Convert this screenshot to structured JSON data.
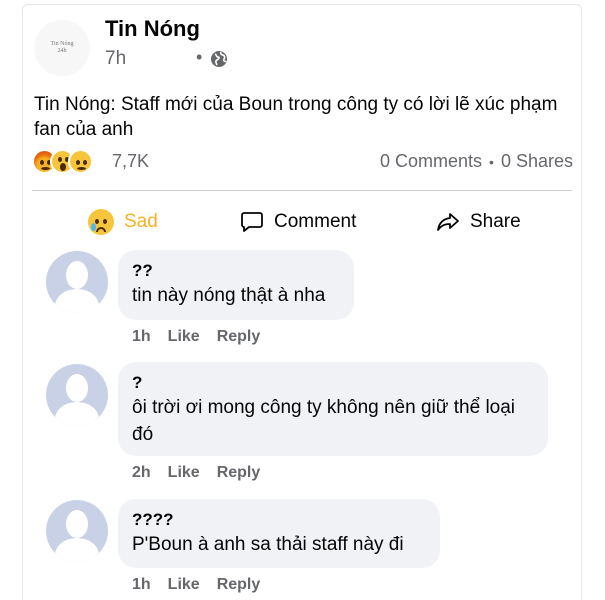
{
  "post": {
    "page_name": "Tin Nóng",
    "avatar_logo_line1": "Tin Nóng",
    "avatar_logo_line2": "24h",
    "time": "7h",
    "separator": "•",
    "privacy_icon": "globe-icon",
    "text": "Tin Nóng: Staff mới của Boun trong công ty có lời lẽ xúc phạm fan của anh"
  },
  "reactions": {
    "icons": [
      "angry-emoji",
      "wow-emoji",
      "sad-emoji"
    ],
    "count": "7,7K",
    "comments": "0 Comments",
    "bullet": "•",
    "shares": "0 Shares"
  },
  "actions": {
    "react_label": "Sad",
    "comment_label": "Comment",
    "share_label": "Share",
    "colors": {
      "sad": "#f7b125",
      "text": "#050505",
      "muted": "#65676b"
    }
  },
  "comments": [
    {
      "author": "??",
      "text": "tin này nóng thật à nha",
      "time": "1h",
      "like": "Like",
      "reply": "Reply"
    },
    {
      "author": "?",
      "text": "ôi trời ơi mong công ty không nên giữ thể loại đó",
      "time": "2h",
      "like": "Like",
      "reply": "Reply"
    },
    {
      "author": "????",
      "text": "P'Boun à anh sa thải staff này đi",
      "time": "1h",
      "like": "Like",
      "reply": "Reply"
    }
  ]
}
